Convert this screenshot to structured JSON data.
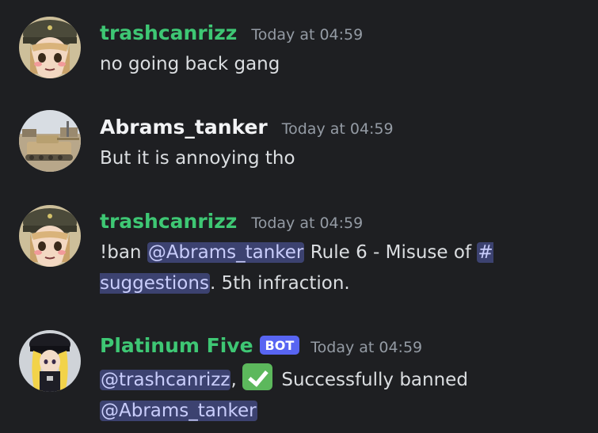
{
  "messages": [
    {
      "username": "trashcanrizz",
      "timestamp": "Today at 04:59",
      "text": "no going back gang"
    },
    {
      "username": "Abrams_tanker",
      "timestamp": "Today at 04:59",
      "text": "But it is annoying tho"
    },
    {
      "username": "trashcanrizz",
      "timestamp": "Today at 04:59",
      "prefix": "!ban ",
      "mention": "@Abrams_tanker",
      "middle": " Rule 6 - Misuse of ",
      "channel_mention": "# suggestions",
      "suffix": ". 5th infraction."
    },
    {
      "username": "Platinum Five",
      "bot_tag": "BOT",
      "timestamp": "Today at 04:59",
      "mention1": "@trashcanrizz",
      "separator": ",",
      "emoji": "white-check-mark",
      "text": " Successfully banned ",
      "mention2": "@Abrams_tanker"
    }
  ],
  "colors": {
    "background": "#1e1f22",
    "username_green": "#3ec774",
    "username_white": "#f2f3f5",
    "timestamp": "#949ba4",
    "message_text": "#dbdee1",
    "mention_bg": "#3c4270",
    "mention_text": "#c9cdfb",
    "bot_tag": "#5865f2"
  }
}
